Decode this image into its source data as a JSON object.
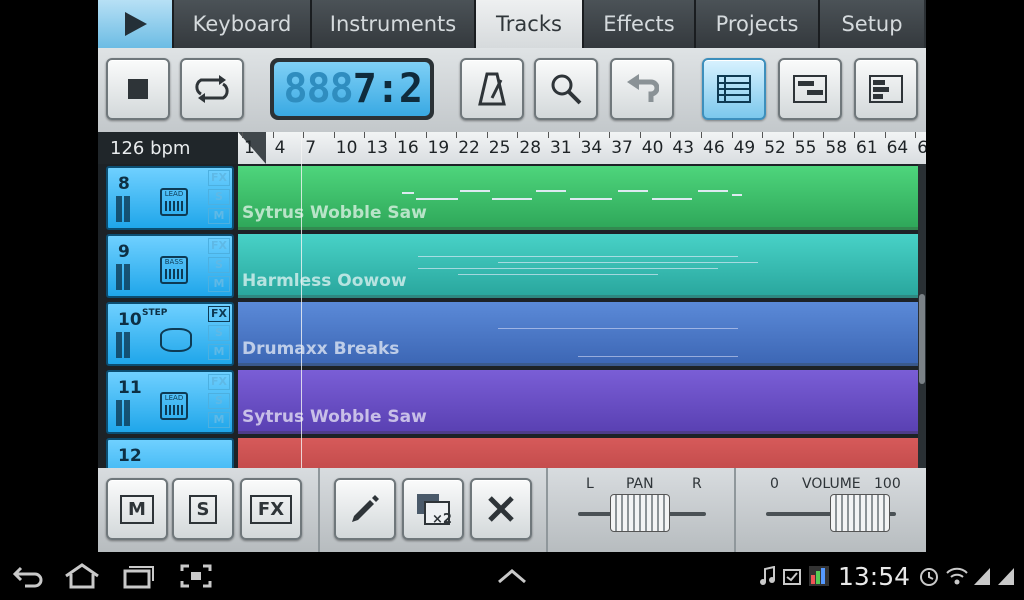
{
  "tabs": [
    "Keyboard",
    "Instruments",
    "Tracks",
    "Effects",
    "Projects",
    "Setup"
  ],
  "active_tab": "Tracks",
  "lcd": {
    "ghost": "888",
    "value": "7:2"
  },
  "bpm": "126 bpm",
  "ruler_ticks": [
    "1",
    "4",
    "7",
    "10",
    "13",
    "16",
    "19",
    "22",
    "25",
    "28",
    "31",
    "34",
    "37",
    "40",
    "43",
    "46",
    "49",
    "52",
    "55",
    "58",
    "61",
    "64",
    "6"
  ],
  "tracks": [
    {
      "num": "8",
      "badge": "LEAD",
      "clip": "Sytrus Wobble Saw",
      "color": "#3fbf6a"
    },
    {
      "num": "9",
      "badge": "BASS",
      "clip": "Harmless Oowow",
      "color": "#35bcb2"
    },
    {
      "num": "10",
      "badge": "STEP",
      "clip": "Drumaxx Breaks",
      "color": "#4a78c9"
    },
    {
      "num": "11",
      "badge": "LEAD",
      "clip": "Sytrus Wobble Saw",
      "color": "#6a4fc8"
    },
    {
      "num": "12",
      "badge": "",
      "clip": "",
      "color": "#c94a4a"
    }
  ],
  "track_buttons": {
    "fx": "FX",
    "s": "S",
    "m": "M"
  },
  "bottom": {
    "m": "M",
    "s": "S",
    "fx": "FX",
    "pan_label": "PAN",
    "pan_l": "L",
    "pan_r": "R",
    "vol_label": "VOLUME",
    "vol_min": "0",
    "vol_max": "100",
    "duplicate": "×2"
  },
  "status": {
    "clock": "13:54"
  }
}
